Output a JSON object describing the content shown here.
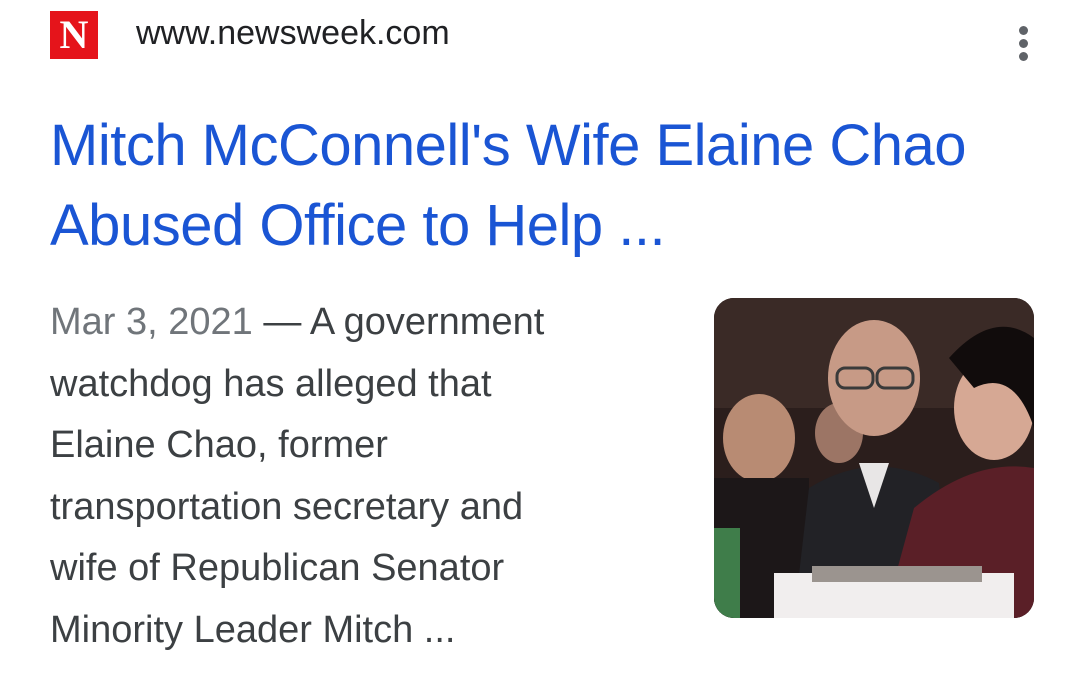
{
  "source": {
    "favicon_letter": "N",
    "favicon_color": "#e5141b",
    "url": "www.newsweek.com",
    "menu_icon": "more-vert-icon"
  },
  "result": {
    "title_line_1": "Mitch McConnell's Wife Elaine Chao",
    "title_line_2": "Abused Office to Help ...",
    "title_color": "#1a55d4",
    "date": "Mar 3, 2021",
    "snippet_lines": [
      " — A government",
      "watchdog has alleged that",
      "Elaine Chao, former",
      "transportation secretary and",
      "wife of Republican Senator",
      "Minority Leader Mitch ..."
    ]
  }
}
